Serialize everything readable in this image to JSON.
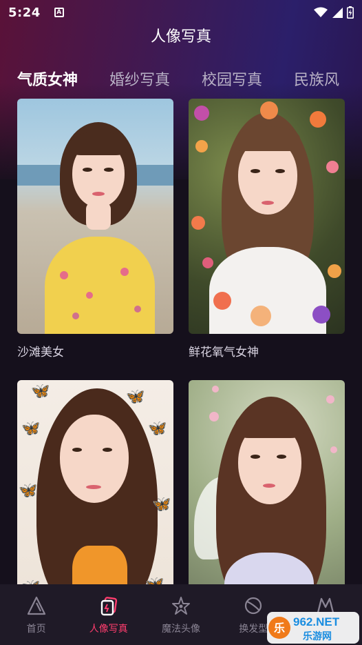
{
  "status": {
    "time": "5:24",
    "notif_icon": "A"
  },
  "page": {
    "title": "人像写真"
  },
  "tabs": [
    {
      "label": "气质女神",
      "active": true
    },
    {
      "label": "婚纱写真",
      "active": false
    },
    {
      "label": "校园写真",
      "active": false
    },
    {
      "label": "民族风",
      "active": false
    }
  ],
  "cards": [
    {
      "label": "沙滩美女",
      "icon": "beach-portrait-photo"
    },
    {
      "label": "鲜花氧气女神",
      "icon": "flower-portrait-photo"
    },
    {
      "label": "",
      "icon": "butterfly-portrait-photo"
    },
    {
      "label": "",
      "icon": "fairy-portrait-photo"
    }
  ],
  "nav": [
    {
      "label": "首页",
      "icon": "home-triangle-icon",
      "active": false
    },
    {
      "label": "人像写真",
      "icon": "portrait-cards-icon",
      "active": true
    },
    {
      "label": "魔法头像",
      "icon": "magic-star-icon",
      "active": false
    },
    {
      "label": "换发型",
      "icon": "hairstyle-icon",
      "active": false
    },
    {
      "label": "",
      "icon": "profile-m-icon",
      "active": false
    }
  ],
  "watermark": {
    "brand": "962.NET",
    "sub": "乐游网"
  },
  "colors": {
    "accent": "#ff3d6e",
    "nav_bg": "#1f1a27",
    "page_bg": "#15101c"
  }
}
